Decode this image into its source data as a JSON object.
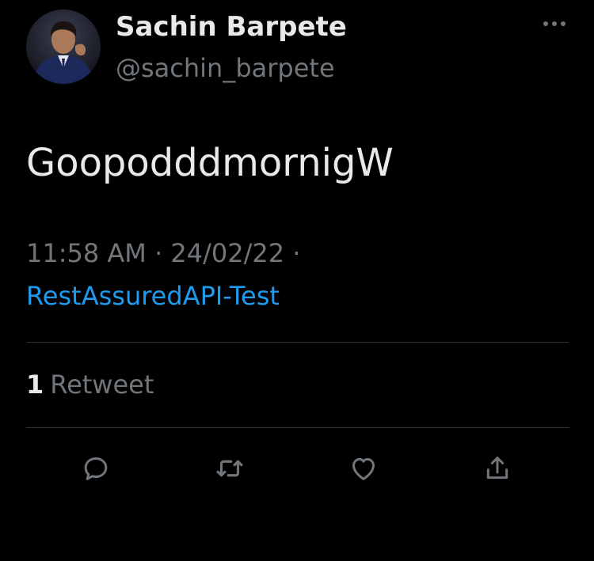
{
  "author": {
    "display_name": "Sachin Barpete",
    "handle": "@sachin_barpete"
  },
  "tweet": {
    "text": "GoopodddmornigW",
    "time": "11:58 AM",
    "separator": "·",
    "date": "24/02/22",
    "source": "RestAssuredAPI-Test"
  },
  "stats": {
    "retweet_count": "1",
    "retweet_label": "Retweet"
  },
  "icons": {
    "more": "more-horizontal-icon",
    "reply": "reply-icon",
    "retweet": "retweet-icon",
    "like": "heart-icon",
    "share": "share-icon"
  },
  "colors": {
    "background": "#000000",
    "primary_text": "#e7e9ea",
    "secondary_text": "#71767b",
    "link": "#1d9bf0",
    "divider": "#2f3336"
  }
}
